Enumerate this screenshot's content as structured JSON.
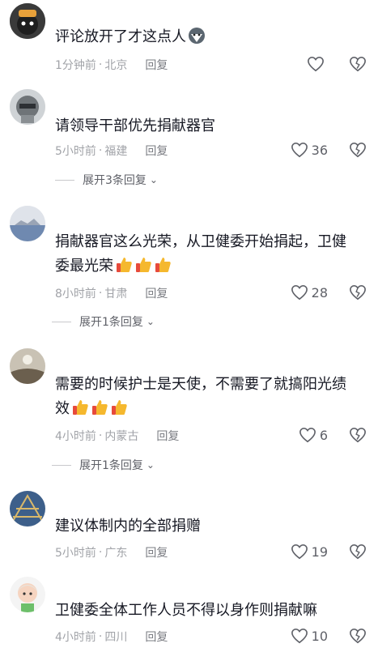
{
  "comments": [
    {
      "text": "评论放开了才这点人",
      "time": "1分钟前",
      "location": "北京",
      "reply": "回复",
      "likes": "",
      "expand": ""
    },
    {
      "text": "请领导干部优先捐献器官",
      "time": "5小时前",
      "location": "福建",
      "reply": "回复",
      "likes": "36",
      "expand": "展开3条回复"
    },
    {
      "text_line1": "捐献器官这么光荣，从卫健委开始捐起，卫健",
      "text_line2": "委最光荣",
      "time": "8小时前",
      "location": "甘肃",
      "reply": "回复",
      "likes": "28",
      "expand": "展开1条回复"
    },
    {
      "text_line1": "需要的时候护士是天使，不需要了就搞阳光绩",
      "text_line2": "效",
      "time": "4小时前",
      "location": "内蒙古",
      "reply": "回复",
      "likes": "6",
      "expand": "展开1条回复"
    },
    {
      "text": "建议体制内的全部捐赠",
      "time": "5小时前",
      "location": "广东",
      "reply": "回复",
      "likes": "19",
      "expand": ""
    },
    {
      "text": "卫健委全体工作人员不得以身作则捐献嘛",
      "time": "4小时前",
      "location": "四川",
      "reply": "回复",
      "likes": "10",
      "expand": ""
    }
  ],
  "separator": "·",
  "icons": {
    "like": "heart-icon",
    "dislike": "broken-heart-icon",
    "expand": "chevron-down-icon",
    "emoji": "thumbs-up-emoji"
  },
  "colors": {
    "text": "#161823",
    "meta": "#a1a3a8",
    "emoji": "#f5b82e"
  }
}
